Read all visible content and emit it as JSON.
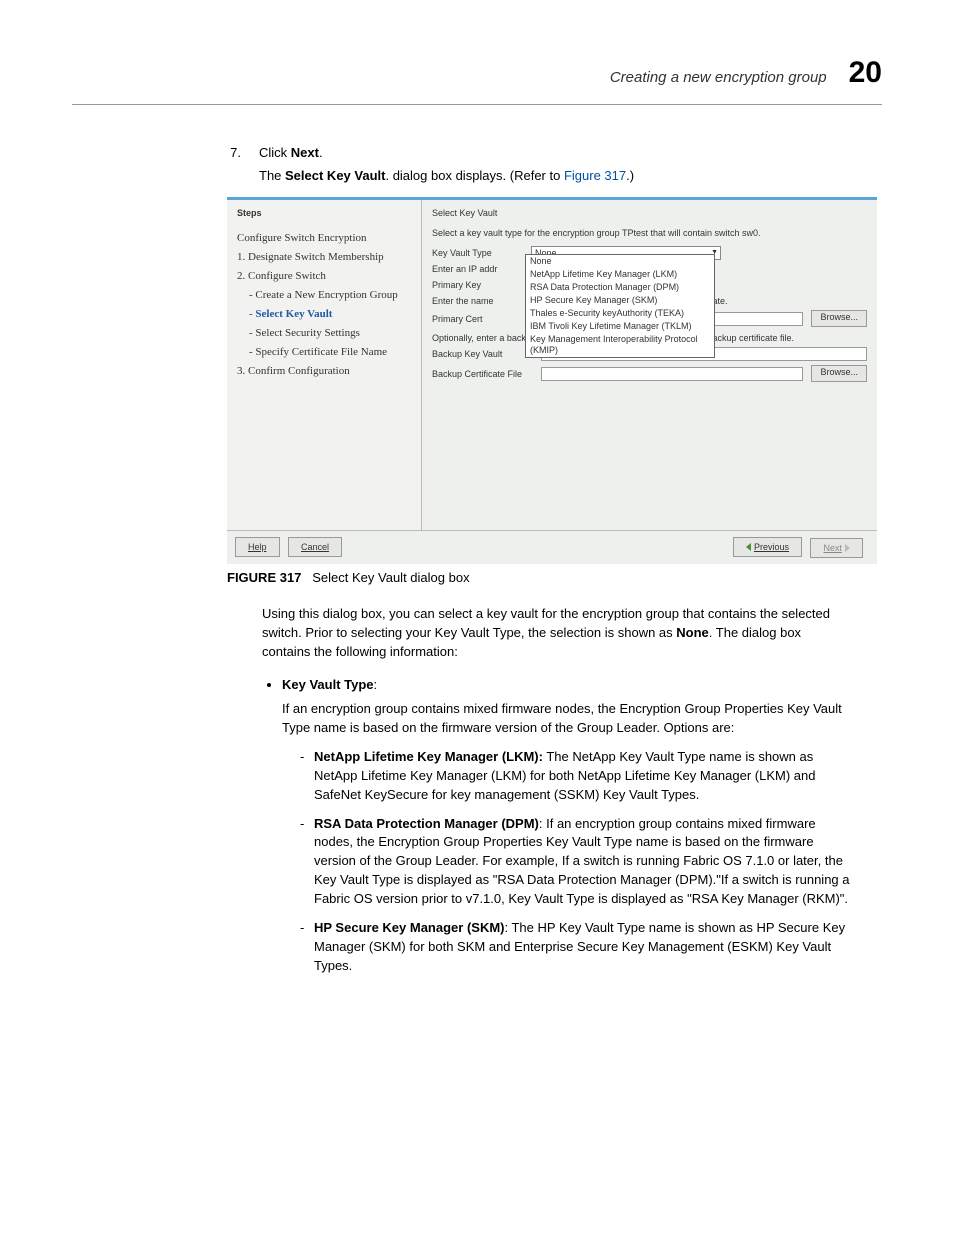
{
  "header": {
    "title": "Creating a new encryption group",
    "chapter": "20"
  },
  "step": {
    "num": "7.",
    "click": "Click ",
    "next": "Next",
    "period": ".",
    "desc_pre": "The ",
    "desc_bold": "Select Key Vault",
    "desc_mid": ". dialog box displays. (Refer to ",
    "desc_link": "Figure 317",
    "desc_post": ".)"
  },
  "dialog": {
    "left": {
      "title": "Steps",
      "head": "Configure Switch Encryption",
      "s1": "1. Designate Switch Membership",
      "s2": "2. Configure Switch",
      "s2a": "- Create a New Encryption Group",
      "s2b": "- Select Key Vault",
      "s2c": "- Select Security Settings",
      "s2d": "- Specify Certificate File Name",
      "s3": "3. Confirm Configuration"
    },
    "right": {
      "title": "Select Key Vault",
      "instr": "Select a key vault type for the encryption group TPtest that will contain switch sw0.",
      "kvt_label": "Key Vault Type",
      "kvt_value": "None",
      "ip_label": "Enter an IP addr",
      "pk_label": "Primary Key",
      "name_label": "Enter the name",
      "name_note": "ertificate.",
      "pcert_label": "Primary Cert",
      "browse": "Browse...",
      "opt_note": "Optionally, enter a backup key vault address (IPv4 or hostname) and backup certificate file.",
      "backup_kv_label": "Backup Key Vault",
      "backup_cert_label": "Backup Certificate File",
      "options": {
        "o0": "None",
        "o1": "NetApp Lifetime Key Manager (LKM)",
        "o2": "RSA Data Protection Manager (DPM)",
        "o3": "HP Secure Key Manager (SKM)",
        "o4": "Thales e-Security keyAuthority (TEKA)",
        "o5": "IBM Tivoli Key Lifetime Manager (TKLM)",
        "o6": "Key Management Interoperability Protocol (KMIP)"
      }
    },
    "footer": {
      "help": "Help",
      "cancel": "Cancel",
      "previous": "Previous",
      "next": "Next"
    }
  },
  "figure": {
    "label": "FIGURE 317",
    "caption": "Select Key Vault dialog box"
  },
  "para1_a": "Using this dialog box, you can select a key vault for the encryption group that contains the selected switch. Prior to selecting your Key Vault Type, the selection is shown as ",
  "para1_bold": "None",
  "para1_b": ". The dialog box contains the following information:",
  "kvt_heading": "Key Vault Type",
  "kvt_heading_colon": ":",
  "kvt_intro": "If an encryption group contains mixed firmware nodes, the Encryption Group Properties Key Vault Type name is based on the firmware version of the Group Leader. Options are:",
  "opt1_bold": "NetApp Lifetime Key Manager (LKM):",
  "opt1_text": " The NetApp Key Vault Type name is shown as NetApp Lifetime Key Manager (LKM) for both NetApp Lifetime Key Manager (LKM) and SafeNet KeySecure for key management (SSKM) Key Vault Types.",
  "opt2_bold": "RSA Data Protection Manager (DPM)",
  "opt2_text": ": If an encryption group contains mixed firmware nodes, the Encryption Group Properties Key Vault Type name is based on the firmware version of the Group Leader. For example, If a switch is running Fabric OS 7.1.0 or later, the Key Vault Type is displayed as \"RSA Data Protection Manager (DPM).\"If a switch is running a Fabric OS version prior to v7.1.0, Key Vault Type is displayed as \"RSA Key Manager (RKM)\".",
  "opt3_bold": "HP Secure Key Manager (SKM)",
  "opt3_text": ": The HP Key Vault Type name is shown as HP Secure Key Manager (SKM) for both SKM and Enterprise Secure Key Management (ESKM) Key Vault Types."
}
